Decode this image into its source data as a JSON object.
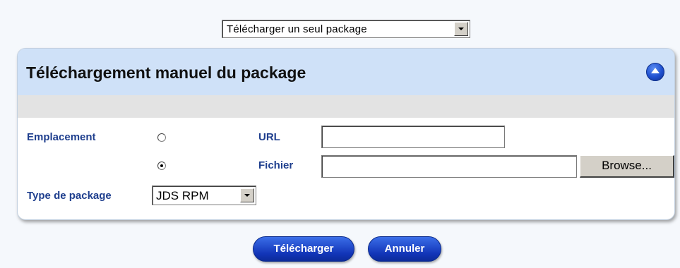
{
  "mode_select": {
    "value": "Télécharger un seul package"
  },
  "panel": {
    "title": "Téléchargement manuel du package",
    "collapse_icon": "chevron-up-circle-icon"
  },
  "form": {
    "location_label": "Emplacement",
    "url_label": "URL",
    "url_value": "",
    "file_label": "Fichier",
    "file_value": "",
    "browse_label": "Browse...",
    "selected_source": "Fichier",
    "package_type_label": "Type de package",
    "package_type_value": "JDS RPM"
  },
  "actions": {
    "upload_label": "Télécharger",
    "cancel_label": "Annuler"
  },
  "colors": {
    "accent": "#1235b8",
    "header_bg": "#cfe1f8",
    "label": "#1f3f8e"
  }
}
